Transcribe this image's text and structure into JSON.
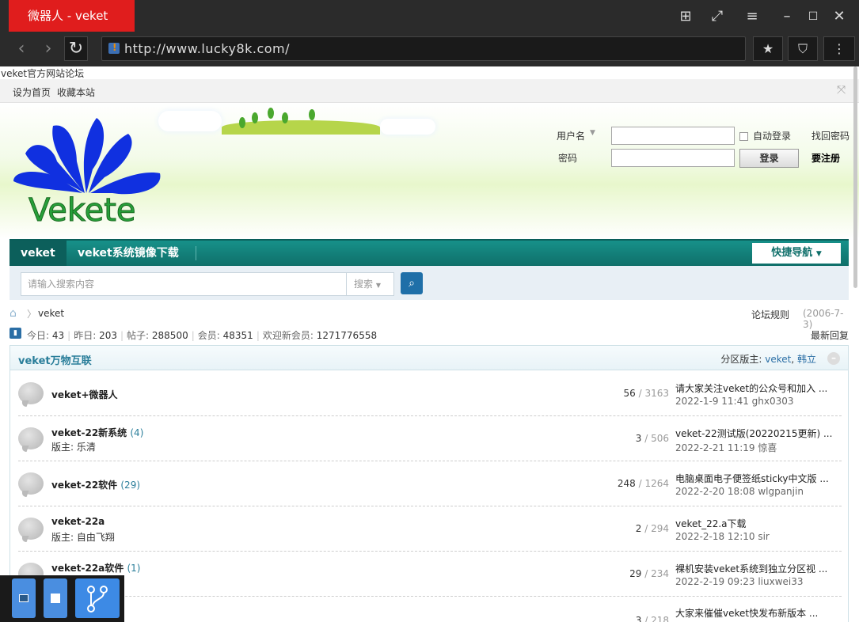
{
  "browser": {
    "tab_title": "微器人 - veket",
    "url": "http://www.lucky8k.com/"
  },
  "page": {
    "site_name_line": "veket官方网站论坛",
    "topbar": {
      "set_home": "设为首页",
      "bookmark": "收藏本站"
    },
    "logo_text": "Vekete",
    "login": {
      "username_label": "用户名",
      "password_label": "密码",
      "auto_login": "自动登录",
      "find_password": "找回密码",
      "login_button": "登录",
      "register": "要注册"
    },
    "nav": {
      "items": [
        "veket",
        "veket系统镜像下载"
      ],
      "quick_nav": "快捷导航"
    },
    "search": {
      "placeholder": "请输入搜索内容",
      "type": "搜索"
    },
    "breadcrumb": {
      "current": "veket",
      "rules": "论坛规则",
      "date": "(2006-7-3)"
    },
    "stats": {
      "today_label": "今日:",
      "today": "43",
      "yesterday_label": "昨日:",
      "yesterday": "203",
      "posts_label": "帖子:",
      "posts": "288500",
      "members_label": "会员:",
      "members": "48351",
      "welcome_label": "欢迎新会员:",
      "newest": "1271776558",
      "latest_reply": "最新回复"
    },
    "forum": {
      "title": "veket万物互联",
      "mods_label": "分区版主:",
      "mods": [
        "veket",
        "韩立"
      ],
      "boards": [
        {
          "name": "veket+微器人",
          "count": "",
          "mod": "",
          "threads": "56",
          "posts": "3163",
          "last_title": "请大家关注veket的公众号和加入 ...",
          "last_meta": "2022-1-9 11:41 ghx0303"
        },
        {
          "name": "veket-22新系统",
          "count": "(4)",
          "mod": "版主: 乐清",
          "threads": "3",
          "posts": "506",
          "last_title": "veket-22测试版(20220215更新) ...",
          "last_meta": "2022-2-21 11:19 惊喜"
        },
        {
          "name": "veket-22软件",
          "count": "(29)",
          "mod": "",
          "threads": "248",
          "posts": "1264",
          "last_title": "电脑桌面电子便签纸sticky中文版 ...",
          "last_meta": "2022-2-20 18:08 wlgpanjin"
        },
        {
          "name": "veket-22a",
          "count": "",
          "mod": "版主: 自由飞翔",
          "threads": "2",
          "posts": "294",
          "last_title": "veket_22.a下载",
          "last_meta": "2022-2-18 12:10 sir"
        },
        {
          "name": "veket-22a软件",
          "count": "(1)",
          "mod": "",
          "threads": "29",
          "posts": "234",
          "last_title": "裸机安装veket系统到独立分区视 ...",
          "last_meta": "2022-2-19 09:23 liuxwei33"
        },
        {
          "name": "",
          "count": "",
          "mod": "",
          "threads": "3",
          "posts": "218",
          "last_title": "大家来催催veket快发布新版本 ...",
          "last_meta": ""
        }
      ]
    }
  }
}
